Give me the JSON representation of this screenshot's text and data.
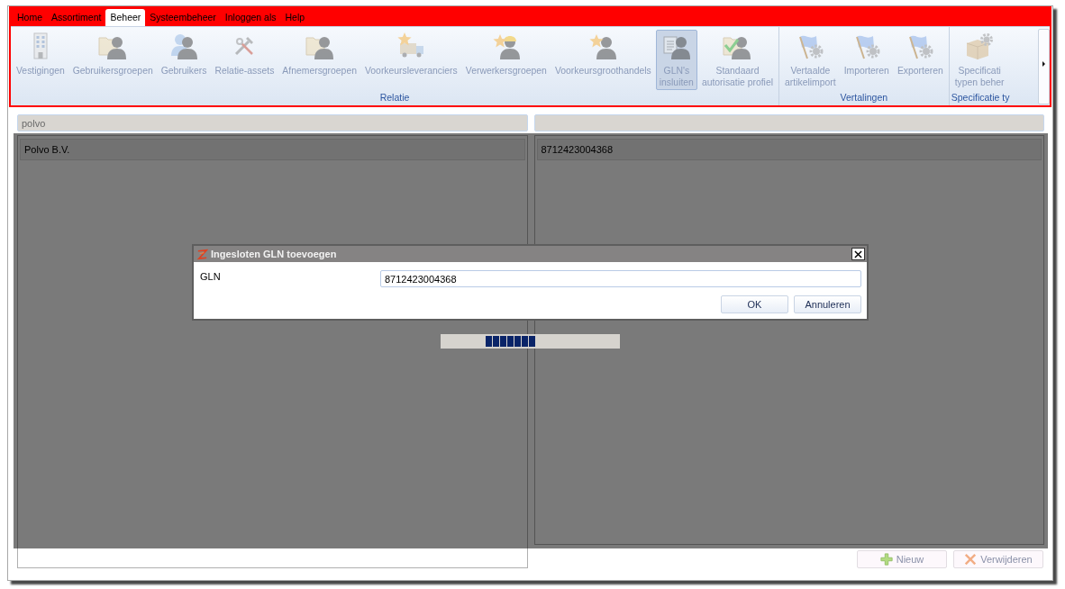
{
  "menu": [
    {
      "label": "Home",
      "selected": false
    },
    {
      "label": "Assortiment",
      "selected": false
    },
    {
      "label": "Beheer",
      "selected": true
    },
    {
      "label": "Systeembeheer",
      "selected": false
    },
    {
      "label": "Inloggen als",
      "selected": false
    },
    {
      "label": "Help",
      "selected": false
    }
  ],
  "ribbon": {
    "groups": [
      {
        "label": "Relatie",
        "items": [
          {
            "label": "Vestigingen",
            "kind": "building",
            "selected": false,
            "disabled": true
          },
          {
            "label": "Gebruikersgroepen",
            "kind": "folder-user",
            "selected": false,
            "disabled": true
          },
          {
            "label": "Gebruikers",
            "kind": "user",
            "selected": false,
            "disabled": true
          },
          {
            "label": "Relatie-assets",
            "kind": "tools",
            "selected": false,
            "disabled": true
          },
          {
            "label": "Afnemersgroepen",
            "kind": "folder-user",
            "selected": false,
            "disabled": true
          },
          {
            "label": "Voorkeursleveranciers",
            "kind": "star-truck",
            "selected": false,
            "disabled": true
          },
          {
            "label": "Verwerkersgroepen",
            "kind": "star-worker",
            "selected": false,
            "disabled": true
          },
          {
            "label": "Voorkeursgroothandels",
            "kind": "star-user",
            "selected": false,
            "disabled": true
          },
          {
            "label": "GLN's\ninsluiten",
            "kind": "document-user",
            "selected": true,
            "disabled": true
          },
          {
            "label": "Standaard\nautorisatie profiel",
            "kind": "check-user",
            "selected": false,
            "disabled": true
          }
        ]
      },
      {
        "label": "Vertalingen",
        "items": [
          {
            "label": "Vertaalde\nartikelimport",
            "kind": "flag-gear",
            "selected": false,
            "disabled": true
          },
          {
            "label": "Importeren",
            "kind": "flag-gear",
            "selected": false,
            "disabled": true
          },
          {
            "label": "Exporteren",
            "kind": "flag-gear",
            "selected": false,
            "disabled": true
          }
        ]
      },
      {
        "label": "Specificatie ty",
        "items": [
          {
            "label": "Specificati\ntypen beher",
            "kind": "box-gear",
            "selected": false,
            "disabled": true
          }
        ]
      }
    ]
  },
  "panels": [
    {
      "filter": "polvo",
      "rows": [
        {
          "label": "Polvo B.V.",
          "selected": true
        }
      ]
    },
    {
      "rows": [
        {
          "label": "8712423004368",
          "selected": true
        }
      ]
    }
  ],
  "actions": [
    {
      "label": "Nieuw",
      "kind": "add",
      "disabled": true
    },
    {
      "label": "Verwijderen",
      "kind": "delete",
      "disabled": true
    }
  ],
  "dialog": {
    "title": "Ingesloten GLN toevoegen",
    "fields": [
      {
        "label": "GLN",
        "value": "8712423004368"
      }
    ],
    "buttons": [
      "OK",
      "Annuleren"
    ]
  }
}
